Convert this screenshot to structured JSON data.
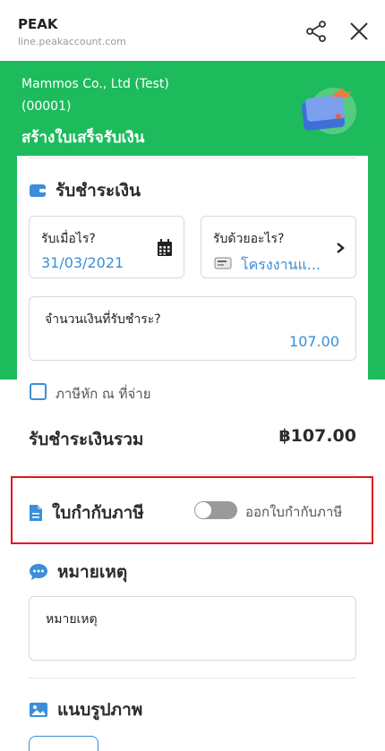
{
  "app": {
    "name": "PEAK",
    "url": "line.peakaccount.com"
  },
  "header": {
    "company_line1": "Mammos Co., Ltd (Test)",
    "company_line2": "(00001)",
    "title": "สร้างใบเสร็จรับเงิน"
  },
  "payment": {
    "section_title": "รับชำระเงิน",
    "date_label": "รับเมื่อไร?",
    "date_value": "31/03/2021",
    "method_label": "รับด้วยอะไร?",
    "method_value": "โครงงานแ...",
    "amount_label": "จำนวนเงินที่รับชำระ?",
    "amount_value": "107.00",
    "withholding_label": "ภาษีหัก ณ ที่จ่าย",
    "total_label": "รับชำระเงินรวม",
    "total_value": "฿107.00"
  },
  "tax_invoice": {
    "section_title": "ใบกำกับภาษี",
    "toggle_label": "ออกใบกำกับภาษี",
    "toggle_on": false
  },
  "note": {
    "section_title": "หมายเหตุ",
    "placeholder": "หมายเหตุ"
  },
  "attachment": {
    "section_title": "แนบรูปภาพ"
  },
  "colors": {
    "brand_green": "#1dbb5c",
    "accent_blue": "#3a8fd8",
    "highlight_red": "#e0141e"
  },
  "icons": [
    "share-icon",
    "close-icon",
    "wallet-illustration",
    "wallet-icon",
    "calendar-icon",
    "chevron-right-icon",
    "bank-icon",
    "document-icon",
    "chat-bubble-icon",
    "image-icon"
  ]
}
